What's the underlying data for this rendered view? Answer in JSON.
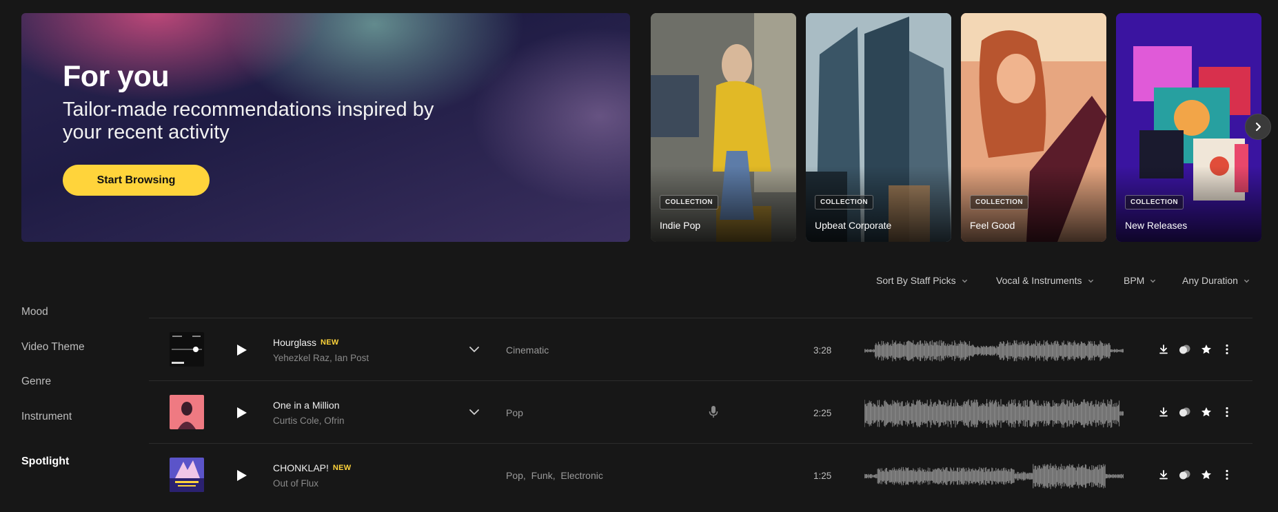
{
  "hero": {
    "title": "For you",
    "subtitle": "Tailor-made recommendations inspired by your recent activity",
    "button_label": "Start Browsing",
    "button_color": "#ffd43b"
  },
  "collections": [
    {
      "badge": "COLLECTION",
      "name": "Indie Pop"
    },
    {
      "badge": "COLLECTION",
      "name": "Upbeat Corporate"
    },
    {
      "badge": "COLLECTION",
      "name": "Feel Good"
    },
    {
      "badge": "COLLECTION",
      "name": "New Releases"
    }
  ],
  "filters": {
    "sort": "Sort By Staff Picks",
    "vocal": "Vocal & Instruments",
    "bpm": "BPM",
    "duration": "Any Duration"
  },
  "sidebar": {
    "items": [
      "Mood",
      "Video Theme",
      "Genre",
      "Instrument"
    ],
    "active": "Spotlight"
  },
  "tracks": [
    {
      "title": "Hourglass",
      "badge": "NEW",
      "artists": "Yehezkel Raz, Ian Post",
      "genre": "Cinematic",
      "duration": "3:28",
      "has_vocals": false,
      "cover_icon": "hourglass-cover"
    },
    {
      "title": "One in a Million",
      "badge": "",
      "artists": "Curtis Cole, Ofrin",
      "genre": "Pop",
      "duration": "2:25",
      "has_vocals": true,
      "cover_icon": "portrait-cover"
    },
    {
      "title": "CHONKLAP!",
      "badge": "NEW",
      "artists": "Out of Flux",
      "genre": "Pop,  Funk,  Electronic",
      "duration": "1:25",
      "has_vocals": false,
      "cover_icon": "chonklap-cover"
    }
  ],
  "accent_color": "#ffd43b"
}
